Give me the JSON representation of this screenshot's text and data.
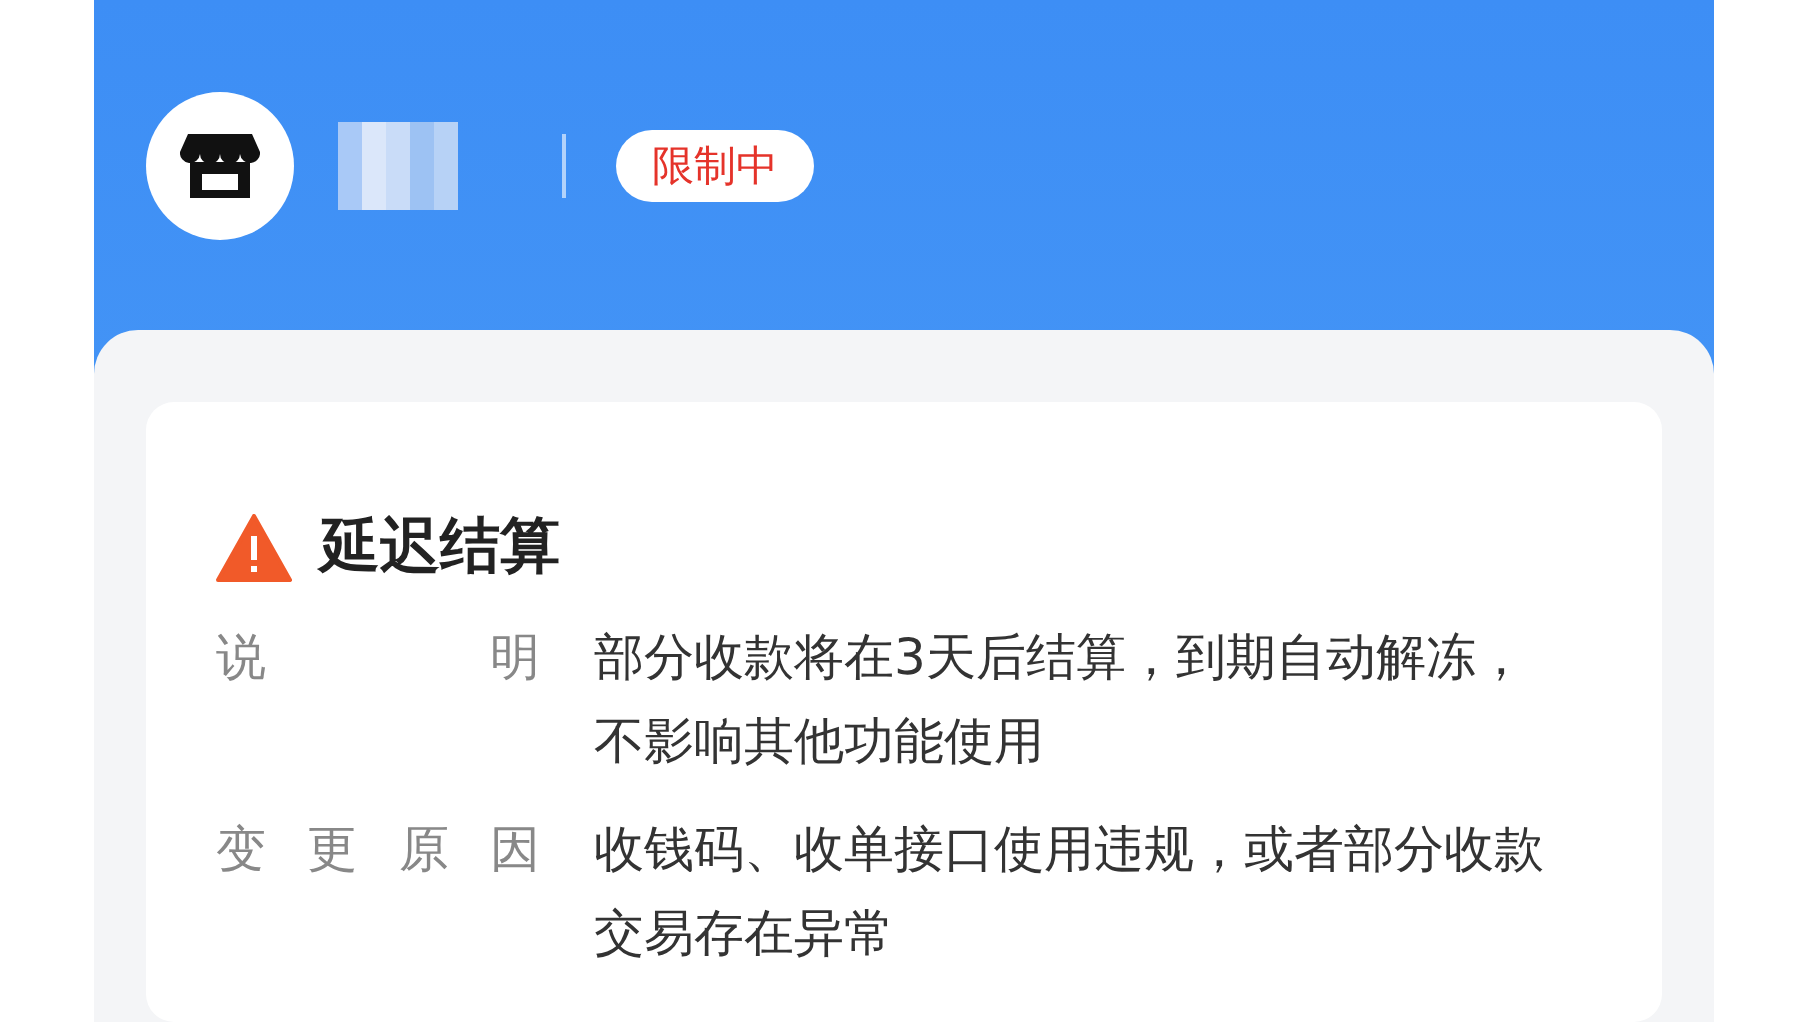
{
  "header": {
    "status_badge": "限制中"
  },
  "restriction": {
    "title": "延迟结算",
    "rows": [
      {
        "label": "说明",
        "value": "部分收款将在3天后结算，到期自动解冻，不影响其他功能使用"
      },
      {
        "label": "变更原因",
        "value": "收钱码、收单接口使用违规，或者部分收款交易存在异常"
      }
    ]
  }
}
